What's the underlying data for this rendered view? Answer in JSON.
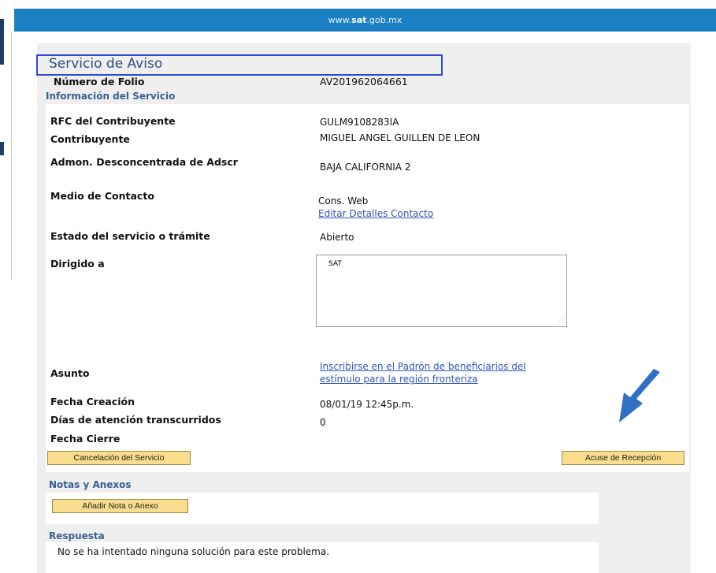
{
  "header": {
    "url_prefix": "www.",
    "url_bold": "sat",
    "url_suffix": ".gob.mx"
  },
  "page": {
    "title": "Servicio de Aviso",
    "folio_label": "Número de Folio",
    "folio_value": "AV201962064661",
    "section_info": "Información del Servicio"
  },
  "fields": {
    "rfc_label": "RFC del Contribuyente",
    "rfc_value": "GULM9108283IA",
    "contribuyente_label": "Contribuyente",
    "contribuyente_value": "MIGUEL ANGEL GUILLEN DE LEON",
    "admon_label": "Admon. Desconcentrada de Adscr",
    "admon_value": "BAJA CALIFORNIA 2",
    "medio_label": "Medio de Contacto",
    "medio_value": "Cons. Web",
    "editar_link": "Editar Detalles Contacto",
    "estado_label": "Estado del servicio o trámite",
    "estado_value": "Abierto",
    "dirigido_label": "Dirigido a",
    "dirigido_value": "SAT",
    "asunto_label": "Asunto",
    "asunto_link_line1": "Inscribirse en el Padrón de beneficiarios del",
    "asunto_link_line2": "estímulo para la región fronteriza",
    "fecha_creacion_label": "Fecha Creación",
    "fecha_creacion_value": "08/01/19 12:45p.m.",
    "dias_label": "Días de atención transcurridos",
    "dias_value": "0",
    "fecha_cierre_label": "Fecha Cierre"
  },
  "buttons": {
    "cancelacion": "Cancelación del Servicio",
    "acuse": "Acuse de Recepción",
    "anadir": "Añadir Nota o Anexo"
  },
  "notas": {
    "label": "Notas y Anexos"
  },
  "respuesta": {
    "label": "Respuesta",
    "text": "No se ha intentado ninguna solución para este problema."
  },
  "colors": {
    "topbar": "#1b7fc4",
    "section": "#3a5f93",
    "button": "#f9dc8c",
    "arrow": "#2f6fc4",
    "highlight_box": "#2b4bd6"
  },
  "icons": {
    "annotation": "arrow-down-left-icon",
    "resize": "resize-grip-icon"
  }
}
